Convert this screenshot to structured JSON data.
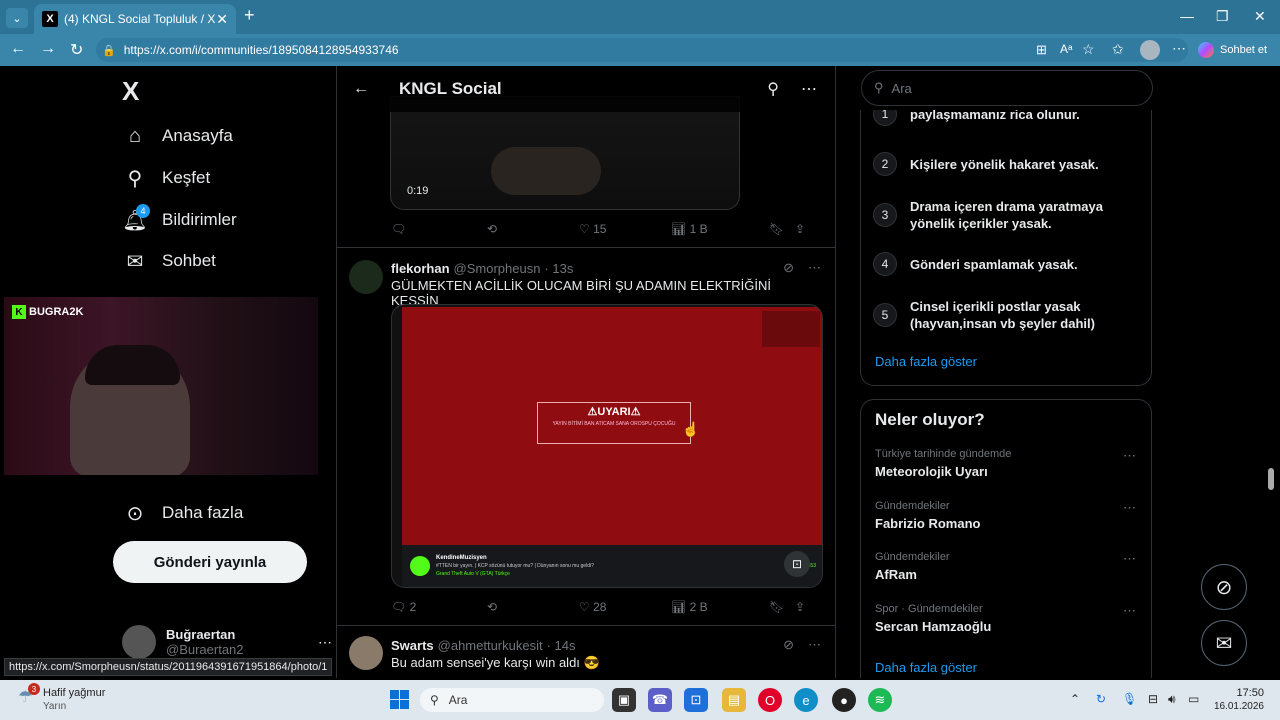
{
  "browser": {
    "tab_title": "(4) KNGL Social Topluluk / X",
    "url": "https://x.com/i/communities/1895084128954933746",
    "sohbet_label": "Sohbet et",
    "status_url": "https://x.com/Smorpheusn/status/2011964391671951864/photo/1"
  },
  "sidebar": {
    "logo": "X",
    "items": [
      {
        "label": "Anasayfa",
        "icon": "home-icon"
      },
      {
        "label": "Keşfet",
        "icon": "search-icon"
      },
      {
        "label": "Bildirimler",
        "icon": "bell-icon",
        "badge": "4"
      },
      {
        "label": "Sohbet",
        "icon": "mail-icon"
      },
      {
        "label": "Daha fazla",
        "icon": "more-circle-icon"
      }
    ],
    "post_button": "Gönderi yayınla",
    "profile": {
      "name": "Buğraertan",
      "handle": "@Buraertan2"
    },
    "webcam_label": "BUGRA2K"
  },
  "header": {
    "title": "KNGL Social"
  },
  "tweets": [
    {
      "video_time": "0:19",
      "replies": "",
      "retweets": "",
      "likes": "15",
      "views": "1 B"
    },
    {
      "name": "flekorhan",
      "handle": "@Smorpheusn",
      "time": "· 13s",
      "text": "GÜLMEKTEN ACİLLİK OLUCAM BİRİ ŞU ADAMIN ELEKTRİĞİNİ KESSİN",
      "warning_title": "⚠UYARI⚠",
      "warning_body": "YAYIN BİTİMİ BAN ATICAM SANA OROSPU ÇOCUĞU",
      "stream_channel": "KendineMuzisyen",
      "stream_title": "#TTEN bir yayın. | KCP sözünü tutuyor mu? | Dünyanın sonu mu geldi?",
      "stream_game": "Grand Theft Auto V (GTA)",
      "stream_lang": "Türkçe",
      "stream_viewers": "4.553",
      "replies": "2",
      "retweets": "",
      "likes": "28",
      "views": "2 B"
    },
    {
      "name": "Swarts",
      "handle": "@ahmetturkukesit",
      "time": "· 14s",
      "text": "Bu adam sensei'ye karşı win aldı 😎"
    }
  ],
  "right": {
    "search_placeholder": "Ara",
    "rules": [
      {
        "num": "1",
        "text": "paylaşmamanız rica olunur."
      },
      {
        "num": "2",
        "text": "Kişilere yönelik hakaret yasak."
      },
      {
        "num": "3",
        "text": "Drama içeren drama yaratmaya yönelik içerikler yasak."
      },
      {
        "num": "4",
        "text": "Gönderi spamlamak yasak."
      },
      {
        "num": "5",
        "text": "Cinsel içerikli postlar yasak (hayvan,insan vb şeyler dahil)"
      }
    ],
    "show_more": "Daha fazla göster",
    "trends_title": "Neler oluyor?",
    "trends": [
      {
        "meta": "Türkiye tarihinde gündemde",
        "name": "Meteorolojik Uyarı"
      },
      {
        "meta": "Gündemdekiler",
        "name": "Fabrizio Romano"
      },
      {
        "meta": "Gündemdekiler",
        "name": "AfRam"
      },
      {
        "meta": "Spor · Gündemdekiler",
        "name": "Sercan Hamzaoğlu"
      }
    ],
    "trends_show_more": "Daha fazla göster"
  },
  "taskbar": {
    "weather_title": "Hafif yağmur",
    "weather_sub": "Yarın",
    "weather_badge": "3",
    "search_label": "Ara",
    "time": "17:50",
    "date": "16.01.2026"
  },
  "colors": {
    "accent": "#1d9bf0",
    "chrome": "#2d7396",
    "warning_red": "#8f0d10"
  }
}
